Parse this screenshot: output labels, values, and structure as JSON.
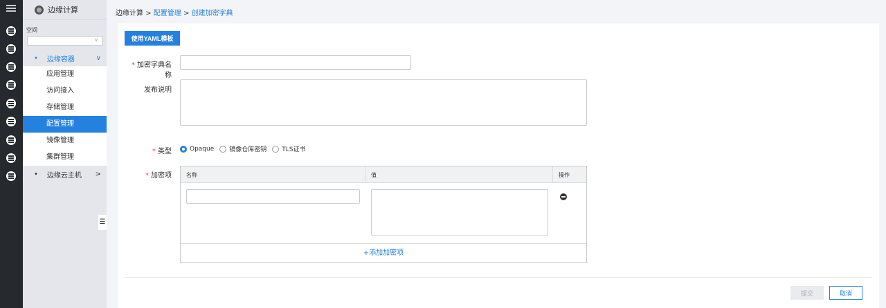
{
  "sidebar": {
    "title": "边缘计算",
    "space_label": "空间",
    "space_value": "",
    "groups": [
      {
        "label": "边缘容器",
        "items": [
          "应用管理",
          "访问接入",
          "存储管理",
          "配置管理",
          "镜像管理",
          "集群管理"
        ]
      },
      {
        "label": "边缘云主机"
      }
    ],
    "active": "配置管理"
  },
  "breadcrumb": {
    "root": "边缘计算",
    "sep": ">",
    "parent": "配置管理",
    "current": "创建加密字典"
  },
  "form": {
    "yaml_button": "使用YAML模板",
    "name_label": "加密字典名称",
    "desc_label": "发布说明",
    "type_label": "类型",
    "types": [
      "Opaque",
      "镜像仓库密钥",
      "TLS证书"
    ],
    "selected_type": "Opaque",
    "items_label": "加密项",
    "columns": [
      "名称",
      "值",
      "操作"
    ],
    "add_item": "+添加加密项",
    "name_value": "",
    "desc_value": ""
  },
  "footer": {
    "submit": "提交",
    "cancel": "取消"
  },
  "colors": {
    "accent": "#2481e0"
  }
}
